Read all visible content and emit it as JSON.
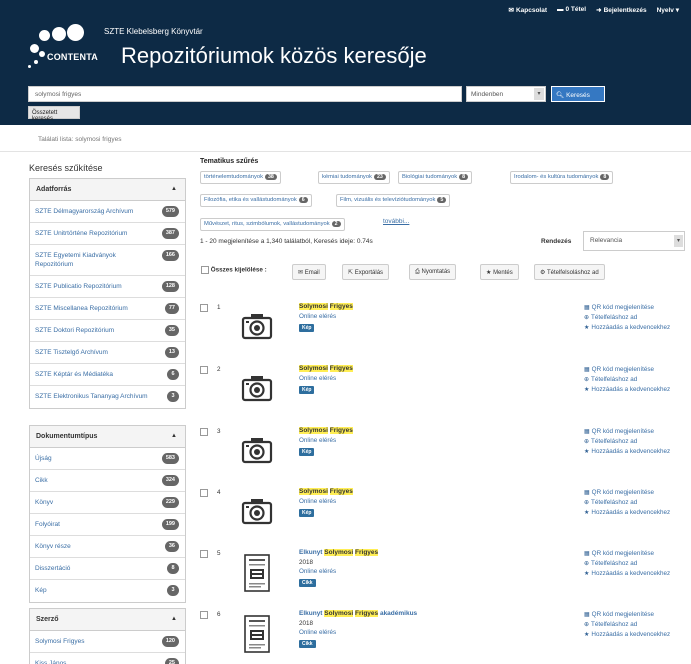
{
  "header": {
    "nav": {
      "contact": "Kapcsolat",
      "cart": "0 Tétel",
      "login": "Bejelentkezés",
      "language": "Nyelv"
    },
    "library_name": "SZTE Klebelsberg Könyvtár",
    "logo_text": "CONTENTA",
    "site_title": "Repozitóriumok közös keresője",
    "search_value": "solymosi frigyes",
    "scope": "Mindenben",
    "search_button": "Keresés",
    "advanced_button": "Összetett keresés"
  },
  "breadcrumb": "Találati lista: solymosi frigyes",
  "sidebar": {
    "title": "Keresés szűkítése",
    "groups": [
      {
        "title": "Adatforrás",
        "items": [
          {
            "label": "SZTE Délmagyarország Archívum",
            "count": "579"
          },
          {
            "label": "SZTE Unitrtörténe Repozitórium",
            "count": "387"
          },
          {
            "label": "SZTE Egyetemi Kiadványok Repozitórium",
            "count": "166"
          },
          {
            "label": "SZTE Publicatio Repozitórium",
            "count": "128"
          },
          {
            "label": "SZTE Miscellanea Repozitórium",
            "count": "77"
          },
          {
            "label": "SZTE Doktori Repozitórium",
            "count": "35"
          },
          {
            "label": "SZTE Tisztelgő Archívum",
            "count": "13"
          },
          {
            "label": "SZTE Képtár és Médiatéka",
            "count": "6"
          },
          {
            "label": "SZTE Elektronikus Tananyag Archívum",
            "count": "3"
          }
        ]
      },
      {
        "title": "Dokumentumtípus",
        "items": [
          {
            "label": "Újság",
            "count": "583"
          },
          {
            "label": "Cikk",
            "count": "324"
          },
          {
            "label": "Könyv",
            "count": "229"
          },
          {
            "label": "Folyóirat",
            "count": "199"
          },
          {
            "label": "Könyv része",
            "count": "36"
          },
          {
            "label": "Disszertáció",
            "count": "8"
          },
          {
            "label": "Kép",
            "count": "3"
          }
        ]
      },
      {
        "title": "Szerző",
        "items": [
          {
            "label": "Solymosi Frigyes",
            "count": "120"
          },
          {
            "label": "Kiss János",
            "count": "25"
          }
        ]
      }
    ]
  },
  "main": {
    "thematic_title": "Tematikus szűrés",
    "chips": [
      {
        "label": "történelemtudományok",
        "count": "38"
      },
      {
        "label": "kémiai tudományok",
        "count": "23"
      },
      {
        "label": "Biológiai tudományok",
        "count": "8"
      },
      {
        "label": "Irodalom- és kultúra tudományok",
        "count": "8"
      },
      {
        "label": "Filozófia, etika és vallástudományok",
        "count": "6"
      },
      {
        "label": "Film, vizuális és televíziótudományok",
        "count": "5"
      },
      {
        "label": "Művészet, ritus, szimbólumok, vallástudományok",
        "count": "2"
      }
    ],
    "more_link": "további...",
    "result_stats": "1 - 20 megjelenítése a 1,340 találatból, Keresés ideje: 0.74s",
    "sort_label": "Rendezés",
    "sort_value": "Relevancia",
    "toolbar": {
      "select_all": "Összes kijelölése",
      "email": "Email",
      "export": "Exportálás",
      "print": "Nyomtatás",
      "save": "Mentés",
      "add_list": "Tételfelsoláshoz ad"
    },
    "results": [
      {
        "num": "1",
        "prefix": "",
        "hl1": "Solymosi",
        "hl2": "Frigyes",
        "suffix": "",
        "year": "",
        "online": "Online elérés",
        "badge": "Kép",
        "thumb": "camera"
      },
      {
        "num": "2",
        "prefix": "",
        "hl1": "Solymosi",
        "hl2": "Frigyes",
        "suffix": "",
        "year": "",
        "online": "Online elérés",
        "badge": "Kép",
        "thumb": "camera"
      },
      {
        "num": "3",
        "prefix": "",
        "hl1": "Solymosi",
        "hl2": "Frigyes",
        "suffix": "",
        "year": "",
        "online": "Online elérés",
        "badge": "Kép",
        "thumb": "camera"
      },
      {
        "num": "4",
        "prefix": "",
        "hl1": "Solymosi",
        "hl2": "Frigyes",
        "suffix": "",
        "year": "",
        "online": "Online elérés",
        "badge": "Kép",
        "thumb": "camera"
      },
      {
        "num": "5",
        "prefix": "Elkunyt",
        "hl1": "Solymosi",
        "hl2": "Frigyes",
        "suffix": "",
        "year": "2018",
        "online": "Online elérés",
        "badge": "Cikk",
        "thumb": "document"
      },
      {
        "num": "6",
        "prefix": "Elkunyt",
        "hl1": "Solymosi",
        "hl2": "Frigyes",
        "suffix": "akadémikus",
        "year": "2018",
        "online": "Online elérés",
        "badge": "Cikk",
        "thumb": "document"
      }
    ],
    "actions": {
      "qr": "QR kód megjelenítése",
      "add": "Tételfeláshoz ad",
      "fav": "Hozzáadás a kedvencekhez"
    }
  }
}
